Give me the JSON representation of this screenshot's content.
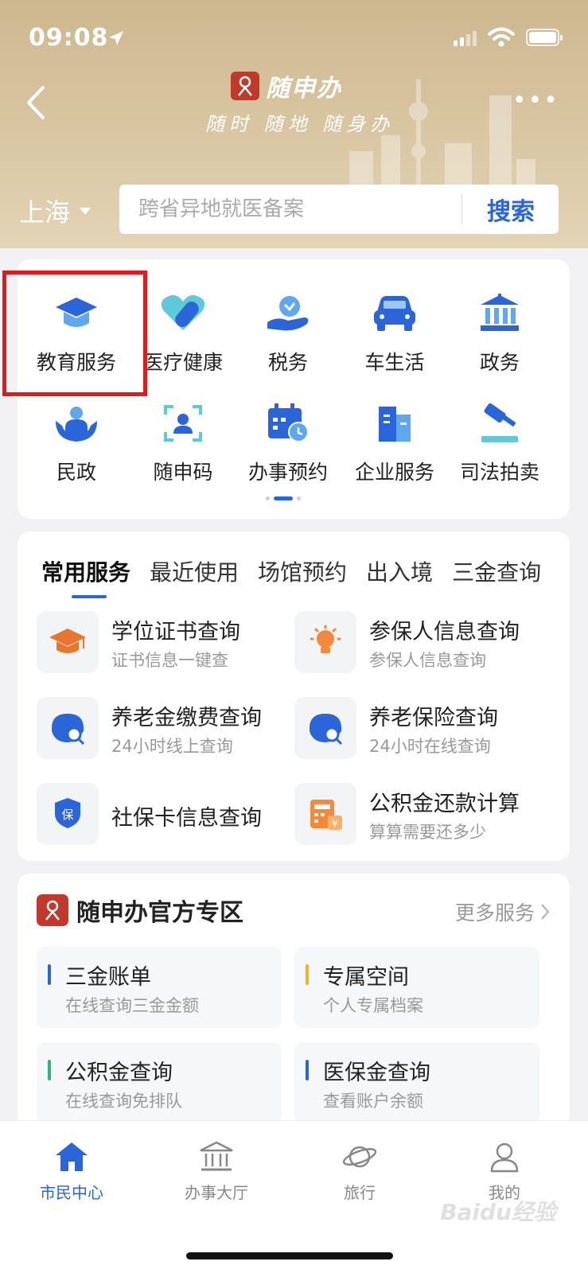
{
  "status_bar": {
    "time": "09:08"
  },
  "header": {
    "brand_name": "随申办",
    "slogan": "随时 随地 随身办",
    "city": "上海",
    "search_placeholder": "跨省异地就医备案",
    "search_button": "搜索"
  },
  "categories": [
    {
      "label": "教育服务",
      "icon": "graduation-cap-icon"
    },
    {
      "label": "医疗健康",
      "icon": "heart-pill-icon"
    },
    {
      "label": "税务",
      "icon": "tax-hand-icon"
    },
    {
      "label": "车生活",
      "icon": "car-icon"
    },
    {
      "label": "政务",
      "icon": "government-building-icon"
    },
    {
      "label": "民政",
      "icon": "civil-affairs-icon"
    },
    {
      "label": "随申码",
      "icon": "face-scan-icon"
    },
    {
      "label": "办事预约",
      "icon": "calendar-clock-icon"
    },
    {
      "label": "企业服务",
      "icon": "office-building-icon"
    },
    {
      "label": "司法拍卖",
      "icon": "gavel-icon"
    }
  ],
  "service_tabs": [
    "常用服务",
    "最近使用",
    "场馆预约",
    "出入境",
    "三金查询"
  ],
  "services": [
    {
      "title": "学位证书查询",
      "subtitle": "证书信息一键查",
      "icon": "graduation-cap-icon"
    },
    {
      "title": "参保人信息查询",
      "subtitle": "参保人信息查询",
      "icon": "lightbulb-icon"
    },
    {
      "title": "养老金缴费查询",
      "subtitle": "24小时线上查询",
      "icon": "search-badge-icon"
    },
    {
      "title": "养老保险查询",
      "subtitle": "24小时在线查询",
      "icon": "search-badge-icon"
    },
    {
      "title": "社保卡信息查询",
      "subtitle": "",
      "icon": "shield-card-icon"
    },
    {
      "title": "公积金还款计算",
      "subtitle": "算算需要还多少",
      "icon": "calculator-icon"
    }
  ],
  "official": {
    "title": "随申办官方专区",
    "more": "更多服务",
    "items": [
      {
        "title": "三金账单",
        "subtitle": "在线查询三金金额",
        "color": "#2a66d9"
      },
      {
        "title": "专属空间",
        "subtitle": "个人专属档案",
        "color": "#f0b429"
      },
      {
        "title": "公积金查询",
        "subtitle": "在线查询免排队",
        "color": "#2eb872"
      },
      {
        "title": "医保金查询",
        "subtitle": "查看账户余额",
        "color": "#2a66d9"
      }
    ]
  },
  "tabbar": [
    {
      "label": "市民中心",
      "icon": "home-icon",
      "active": true
    },
    {
      "label": "办事大厅",
      "icon": "bank-icon",
      "active": false
    },
    {
      "label": "旅行",
      "icon": "planet-icon",
      "active": false
    },
    {
      "label": "我的",
      "icon": "user-icon",
      "active": false
    }
  ],
  "watermark": "Baidu经验",
  "colors": {
    "accent": "#2a66d9",
    "highlight": "#e21a1a",
    "header": "#cdb88f"
  }
}
